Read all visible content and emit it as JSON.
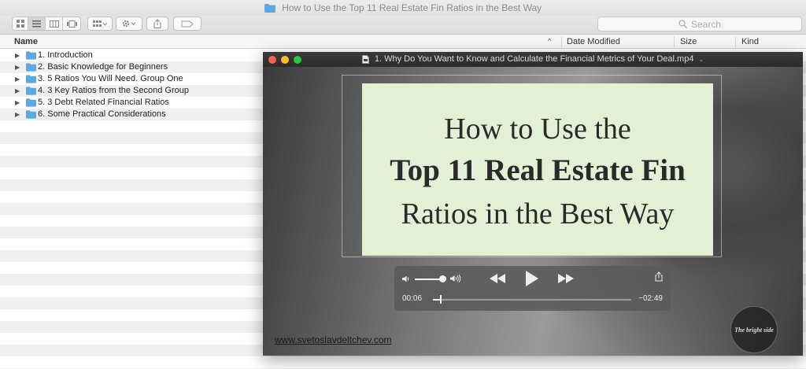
{
  "finder": {
    "window_title": "How to Use the Top 11 Real Estate Fin Ratios in the Best Way",
    "search_placeholder": "Search",
    "columns": {
      "name": "Name",
      "date_modified": "Date Modified",
      "size": "Size",
      "kind": "Kind"
    },
    "folders": [
      {
        "label": "1. Introduction"
      },
      {
        "label": "2. Basic Knowledge for Beginners"
      },
      {
        "label": "3. 5 Ratios You Will Need. Group One"
      },
      {
        "label": "4. 3 Key Ratios from the Second Group"
      },
      {
        "label": "5. 3 Debt Related Financial Ratios"
      },
      {
        "label": "6. Some Practical Considerations"
      }
    ]
  },
  "player": {
    "window_title": "1. Why Do You Want to Know and Calculate the Financial Metrics of Your Deal.mp4",
    "title_card": {
      "line1": "How to Use the",
      "line2": "Top 11 Real Estate Fin",
      "line3": "Ratios in the Best Way"
    },
    "time_elapsed": "00:06",
    "time_remaining": "−02:49",
    "progress_fraction": 0.035,
    "website": "www.svetoslavdeltchev.com",
    "logo_text": "The bright side"
  },
  "colors": {
    "title_card_bg": "#e4f0d6",
    "folder_blue": "#5aa9e6",
    "traffic_red": "#fe5f57",
    "traffic_yellow": "#febc2e",
    "traffic_green": "#28c840"
  },
  "icons": [
    "folder-icon",
    "search-icon",
    "disclosure-triangle-icon",
    "volume-low-icon",
    "volume-high-icon",
    "rewind-icon",
    "play-icon",
    "fast-forward-icon",
    "share-icon"
  ]
}
